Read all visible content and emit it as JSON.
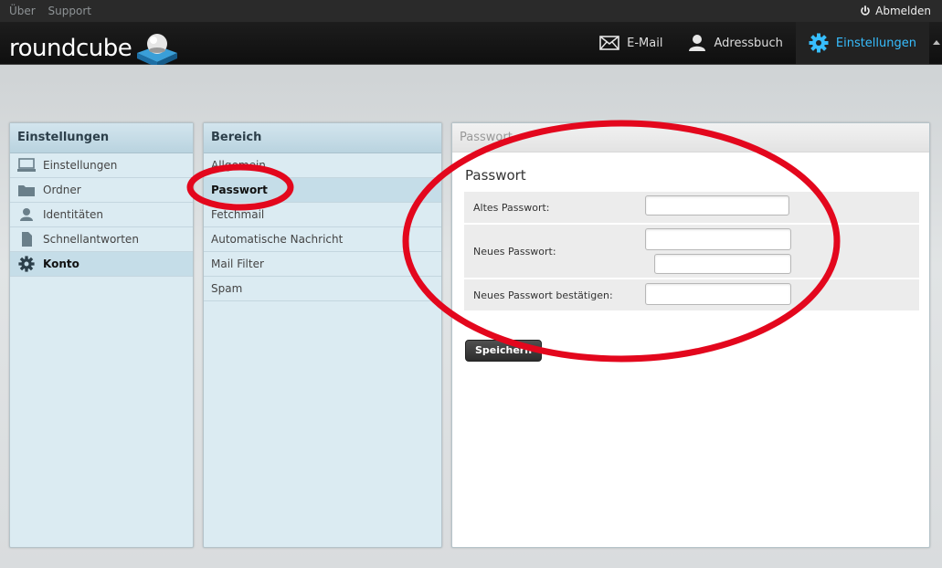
{
  "topline": {
    "links": [
      "Über",
      "Support"
    ],
    "logout_label": "Abmelden"
  },
  "header": {
    "logo_text": "roundcube",
    "tasks": [
      {
        "label": "E-Mail",
        "icon": "envelope-icon"
      },
      {
        "label": "Adressbuch",
        "icon": "person-icon"
      },
      {
        "label": "Einstellungen",
        "icon": "gear-icon",
        "active": true
      }
    ],
    "colors": {
      "active_task": "#37beff",
      "annotation": "#e3071d"
    }
  },
  "sections_panel": {
    "title": "Einstellungen",
    "items": [
      {
        "label": "Einstellungen",
        "icon": "monitor-icon"
      },
      {
        "label": "Ordner",
        "icon": "folder-icon"
      },
      {
        "label": "Identitäten",
        "icon": "identity-icon"
      },
      {
        "label": "Schnellantworten",
        "icon": "document-icon"
      },
      {
        "label": "Konto",
        "icon": "gear-icon",
        "selected": true
      }
    ]
  },
  "area_panel": {
    "title": "Bereich",
    "items": [
      {
        "label": "Allgemein"
      },
      {
        "label": "Passwort",
        "selected": true
      },
      {
        "label": "Fetchmail"
      },
      {
        "label": "Automatische Nachricht"
      },
      {
        "label": "Mail Filter"
      },
      {
        "label": "Spam"
      }
    ]
  },
  "content": {
    "header_title": "Passwort",
    "form_title": "Passwort",
    "fields": {
      "old_password": {
        "label": "Altes Passwort:",
        "value": ""
      },
      "new_password": {
        "label": "Neues Passwort:",
        "value": "",
        "strength_value": ""
      },
      "confirm_password": {
        "label": "Neues Passwort bestätigen:",
        "value": ""
      }
    },
    "save_label": "Speichern"
  }
}
